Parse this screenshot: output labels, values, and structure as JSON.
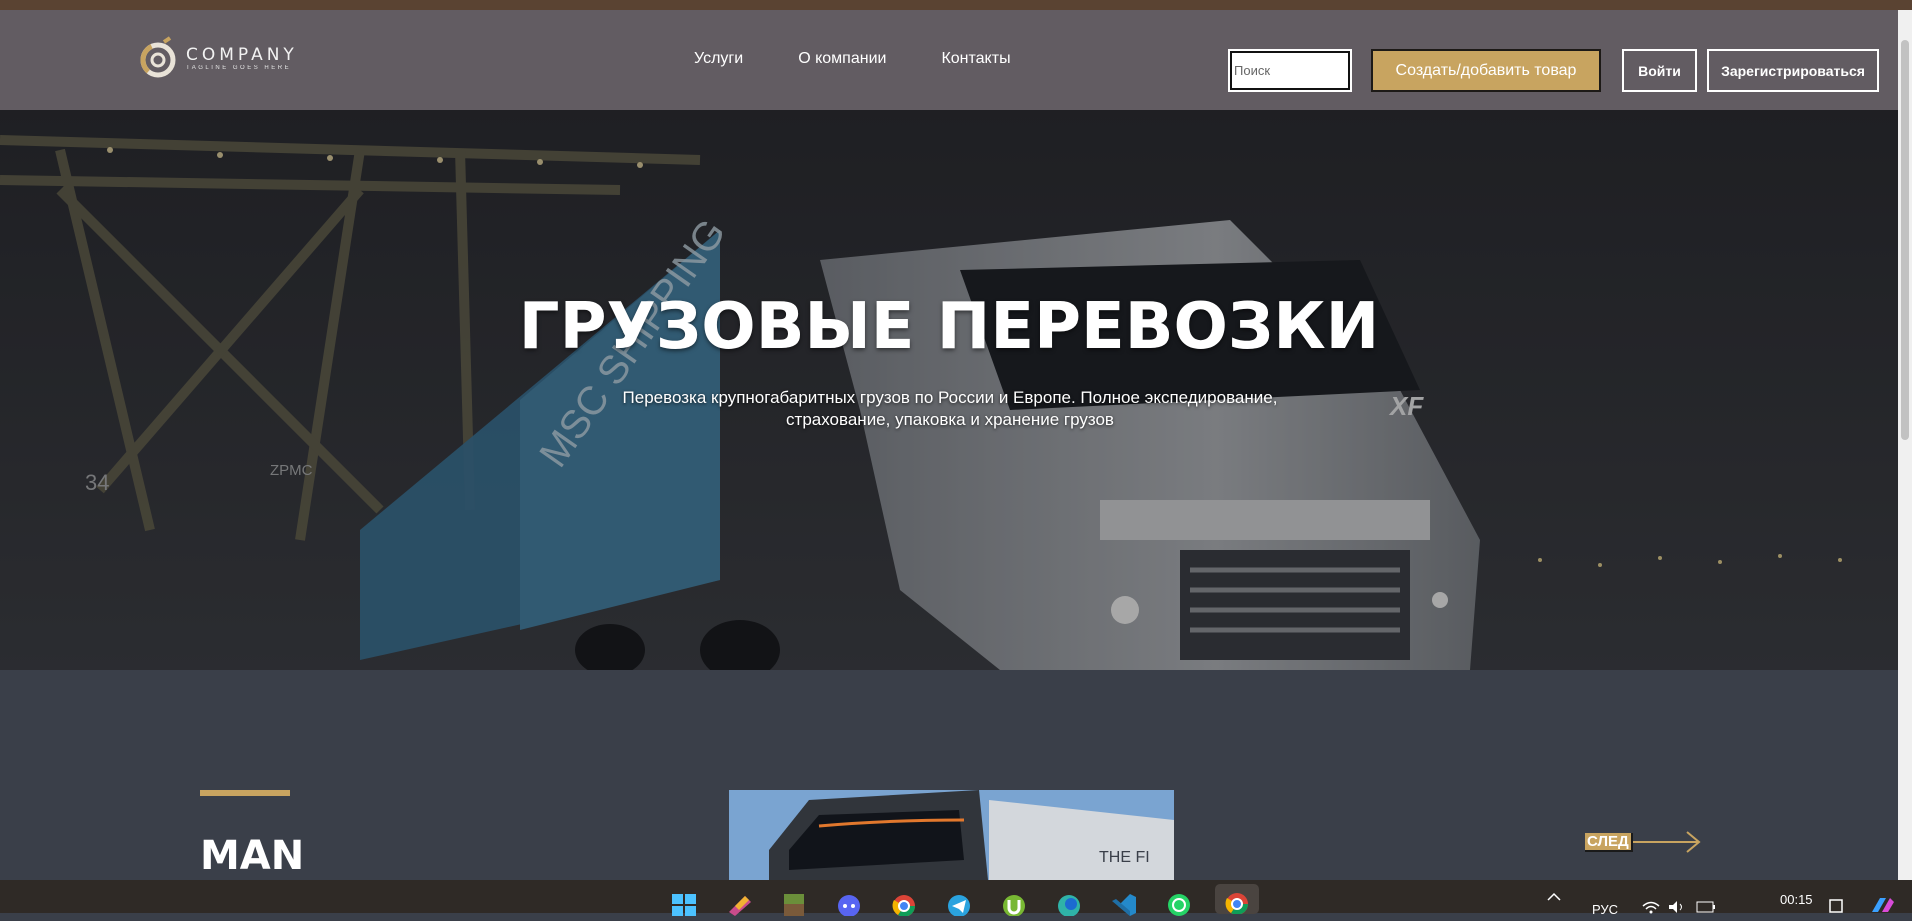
{
  "header": {
    "logo": {
      "name": "COMPANY",
      "tagline": "TAGLINE GOES HERE"
    },
    "nav": [
      {
        "label": "Услуги"
      },
      {
        "label": "О компании"
      },
      {
        "label": "Контакты"
      }
    ],
    "search": {
      "placeholder": "Поиск",
      "value": ""
    },
    "create_button": "Создать/добавить товар",
    "login_button": "Войти",
    "register_button": "Зарегистрироваться"
  },
  "hero": {
    "title": "ГРУЗОВЫЕ ПЕРЕВОЗКИ",
    "subtitle_line1": "Перевозка крупногабаритных грузов по России и Европе. Полное экспедирование,",
    "subtitle_line2": "страхование, упаковка и хранение грузов",
    "truck_badge": "XF",
    "container_text": "MSC SHIPPING",
    "crane_number": "34",
    "crane_brand": "ZPMC"
  },
  "slider": {
    "brand": "MAN",
    "product_caption": "THE FI",
    "next_label": "СЛЕД"
  },
  "taskbar": {
    "language": "РУС",
    "time": "00:15",
    "icons": [
      "windows-start-icon",
      "app-icon",
      "minecraft-icon",
      "discord-icon",
      "chrome-icon",
      "telegram-icon",
      "utorrent-icon",
      "edge-icon",
      "vscode-icon",
      "whatsapp-icon",
      "chrome-active-icon"
    ]
  },
  "colors": {
    "accent_gold": "#c8a460",
    "header_bg": "#625c62",
    "section_bg": "#3a3f49",
    "top_strip": "#5a4332"
  }
}
